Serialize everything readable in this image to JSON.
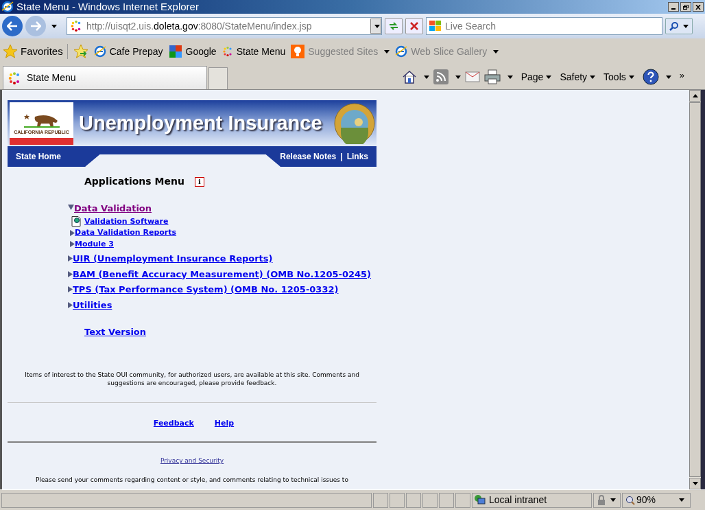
{
  "window": {
    "title": "State Menu - Windows Internet Explorer"
  },
  "address": {
    "before": "http://uisqt2.uis.",
    "domain": "doleta.gov",
    "after": ":8080/StateMenu/index.jsp"
  },
  "search": {
    "placeholder": "Live Search"
  },
  "favorites_label": "Favorites",
  "favorites": [
    {
      "label": "Cafe Prepay",
      "kind": "ie",
      "disabled": false,
      "menu": false
    },
    {
      "label": "Google",
      "kind": "google",
      "disabled": false,
      "menu": false
    },
    {
      "label": "State Menu",
      "kind": "dots",
      "disabled": false,
      "menu": false
    },
    {
      "label": "Suggested Sites",
      "kind": "bulb",
      "disabled": true,
      "menu": true
    },
    {
      "label": "Web Slice Gallery",
      "kind": "ie",
      "disabled": true,
      "menu": true
    }
  ],
  "tab": {
    "label": "State Menu"
  },
  "commands": [
    "Page",
    "Safety",
    "Tools"
  ],
  "overflow": "»",
  "page": {
    "banner_title": "Unemployment Insurance",
    "flag_text": "CALIFORNIA REPUBLIC",
    "nav_left": "State Home",
    "nav_right": [
      "Release Notes",
      "Links"
    ],
    "nav_separator": "|",
    "heading": "Applications Menu",
    "info_badge": "i",
    "menu": [
      {
        "label": "Data Validation",
        "expanded": true,
        "visited": true,
        "kind": "arrow",
        "children": [
          {
            "label": "Validation Software",
            "kind": "document",
            "visited": false
          },
          {
            "label": "Data Validation Reports",
            "kind": "arrow",
            "expanded": false,
            "visited": false
          },
          {
            "label": "Module 3",
            "kind": "arrow",
            "expanded": false,
            "visited": false
          }
        ]
      },
      {
        "label": "UIR (Unemployment Insurance Reports)",
        "kind": "arrow",
        "expanded": false,
        "visited": false
      },
      {
        "label": "BAM (Benefit Accuracy Measurement) (OMB No.1205-0245)",
        "kind": "arrow",
        "expanded": false,
        "visited": false
      },
      {
        "label": "TPS (Tax Performance System) (OMB No. 1205-0332)",
        "kind": "arrow",
        "expanded": false,
        "visited": false
      },
      {
        "label": "Utilities",
        "kind": "arrow",
        "expanded": false,
        "visited": false
      }
    ],
    "text_version": "Text Version",
    "intro": "Items of interest to the State OUI community, for authorized users, are available at this site. Comments and suggestions are encouraged, please provide feedback.",
    "footer_links": [
      "Feedback",
      "Help"
    ],
    "privacy": "Privacy and Security",
    "comments": "Please send your comments regarding content or style, and comments relating to technical issues to"
  },
  "status_bar": {
    "zone": "Local intranet",
    "zoom": "90%"
  }
}
